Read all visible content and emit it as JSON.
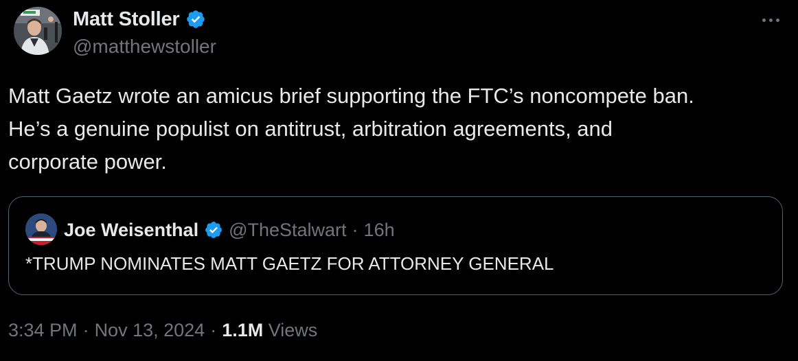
{
  "author": {
    "display_name": "Matt Stoller",
    "handle": "@matthewstoller",
    "verified": true,
    "avatar_icon": "profile-photo"
  },
  "tweet": {
    "text_lines": [
      "Matt Gaetz wrote an amicus brief supporting the FTC’s noncompete ban.",
      "He’s a genuine populist on antitrust, arbitration agreements, and",
      "corporate power."
    ]
  },
  "quote": {
    "display_name": "Joe Weisenthal",
    "handle": "@TheStalwart",
    "separator": "·",
    "time": "16h",
    "verified": true,
    "text": "*TRUMP NOMINATES MATT GAETZ FOR ATTORNEY GENERAL"
  },
  "meta": {
    "time": "3:34 PM",
    "separator": "·",
    "date": "Nov 13, 2024",
    "views_count": "1.1M",
    "views_label": "Views"
  },
  "colors": {
    "background": "#000000",
    "text_primary": "#e7e9ea",
    "text_secondary": "#71767b",
    "verified_blue": "#1d9bf0",
    "border": "#536471"
  }
}
